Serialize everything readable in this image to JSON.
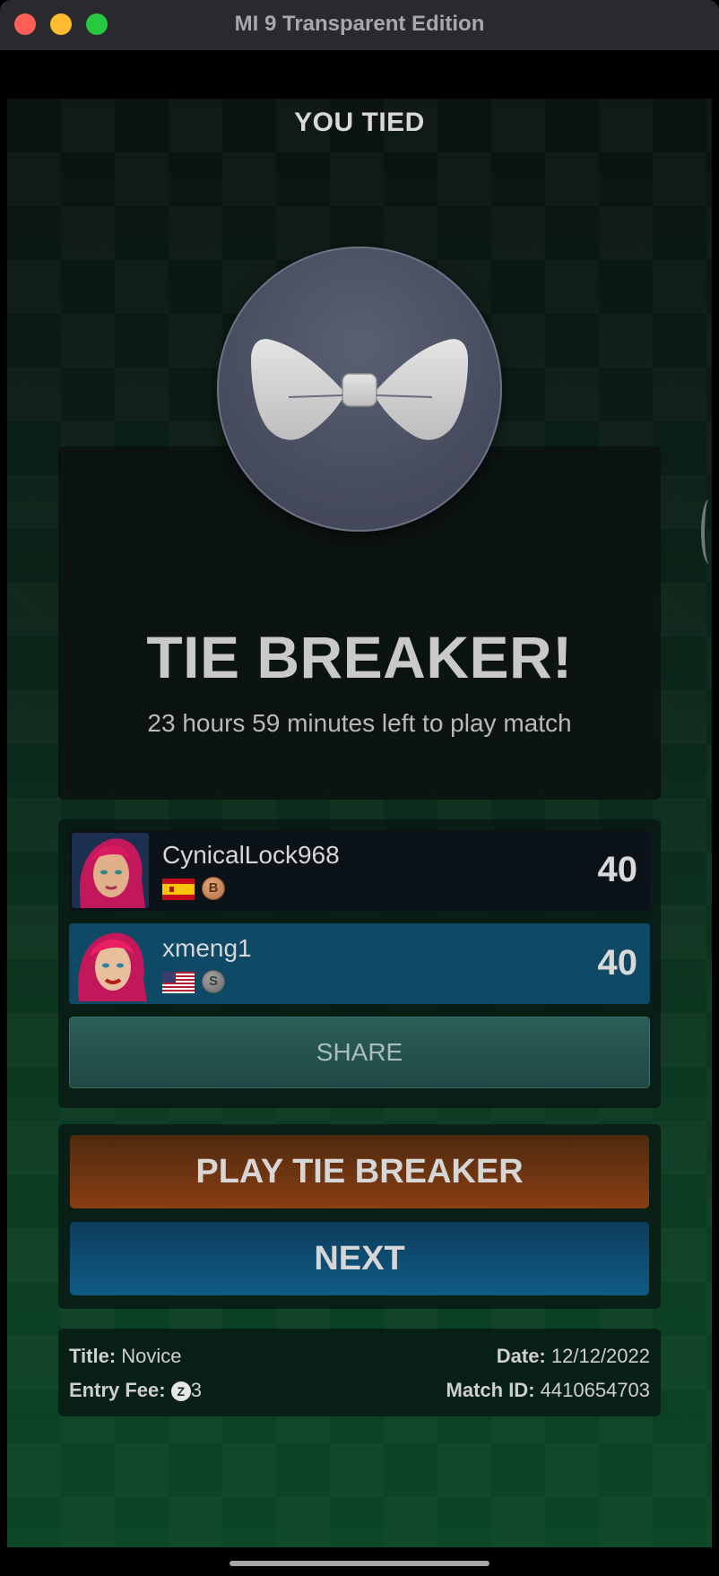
{
  "window": {
    "title": "MI 9 Transparent Edition"
  },
  "result": {
    "header": "YOU TIED",
    "headline": "TIE BREAKER!",
    "subtitle": "23 hours 59 minutes left to play match"
  },
  "players": [
    {
      "name": "CynicalLock968",
      "score": "40",
      "flag": "spain-flag",
      "badge": "B",
      "badge_type": "bronze"
    },
    {
      "name": "xmeng1",
      "score": "40",
      "flag": "usa-flag",
      "badge": "S",
      "badge_type": "silver"
    }
  ],
  "share_label": "SHARE",
  "actions": {
    "play_tie_breaker": "PLAY TIE BREAKER",
    "next": "NEXT"
  },
  "match_info": {
    "title_label": "Title:",
    "title_value": "Novice",
    "entry_fee_label": "Entry Fee:",
    "entry_fee_icon": "Z",
    "entry_fee_value": "3",
    "date_label": "Date:",
    "date_value": "12/12/2022",
    "match_id_label": "Match ID:",
    "match_id_value": "4410654703"
  },
  "colors": {
    "orange_button": "#8a3e14",
    "blue_button": "#0f5a86",
    "highlight_row": "#0e4a66",
    "share_button": "#2c5e5a"
  }
}
